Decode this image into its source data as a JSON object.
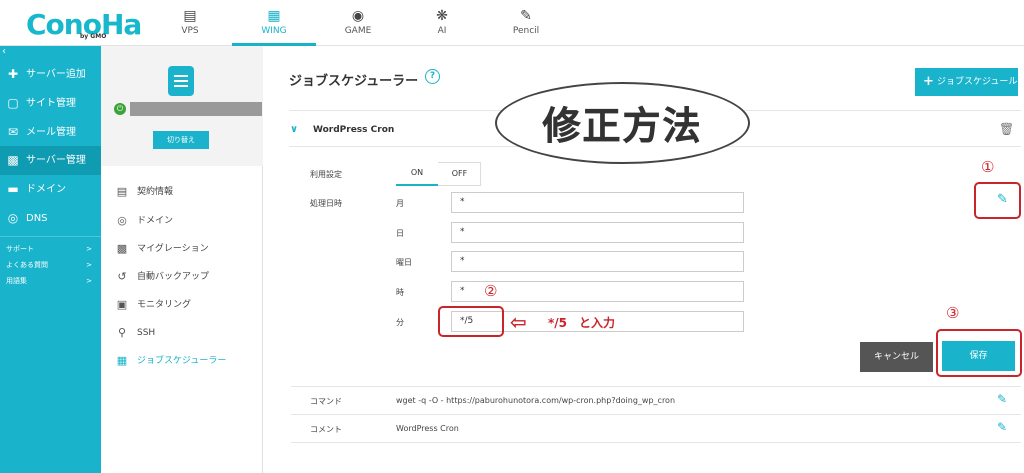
{
  "brand": {
    "logo": "ConoHa",
    "sub": "by GMO"
  },
  "topnav": [
    {
      "label": "VPS",
      "icon": "server-stack-icon"
    },
    {
      "label": "WING",
      "icon": "wing-icon",
      "active": true
    },
    {
      "label": "GAME",
      "icon": "gamepad-icon"
    },
    {
      "label": "AI",
      "icon": "ai-brain-icon"
    },
    {
      "label": "Pencil",
      "icon": "pencil-note-icon"
    }
  ],
  "sidebar": {
    "collapse": "‹",
    "items": [
      {
        "label": "サーバー追加",
        "icon": "plus-icon"
      },
      {
        "label": "サイト管理",
        "icon": "site-icon"
      },
      {
        "label": "メール管理",
        "icon": "mail-icon"
      },
      {
        "label": "サーバー管理",
        "icon": "server-icon",
        "selected": true
      },
      {
        "label": "ドメイン",
        "icon": "domain-icon"
      },
      {
        "label": "DNS",
        "icon": "globe-icon"
      }
    ],
    "links": [
      {
        "label": "サポート"
      },
      {
        "label": "よくある質問"
      },
      {
        "label": "用語集"
      }
    ]
  },
  "server_panel": {
    "switch_label": "切り替え",
    "menu": [
      {
        "label": "契約情報",
        "icon": "contract-icon"
      },
      {
        "label": "ドメイン",
        "icon": "globe-icon"
      },
      {
        "label": "マイグレーション",
        "icon": "migration-icon"
      },
      {
        "label": "自動バックアップ",
        "icon": "backup-icon"
      },
      {
        "label": "モニタリング",
        "icon": "monitor-icon"
      },
      {
        "label": "SSH",
        "icon": "key-icon"
      },
      {
        "label": "ジョブスケジューラー",
        "icon": "scheduler-icon",
        "selected": true
      }
    ]
  },
  "main": {
    "title": "ジョブスケジューラー",
    "help": "?",
    "add_button": "ジョブスケジュール",
    "overlay_text": "修正方法",
    "section_title": "WordPress Cron",
    "usage_label": "利用設定",
    "toggle": {
      "on": "ON",
      "off": "OFF"
    },
    "schedule_label": "処理日時",
    "fields": [
      {
        "label": "月",
        "value": "*"
      },
      {
        "label": "日",
        "value": "*"
      },
      {
        "label": "曜日",
        "value": "*"
      },
      {
        "label": "時",
        "value": "*"
      },
      {
        "label": "分",
        "value": "*/5"
      }
    ],
    "annotations": {
      "one": "①",
      "two": "②",
      "three": "③",
      "arrow": "⇦",
      "note": "*/5　と入力"
    },
    "cancel": "キャンセル",
    "save": "保存",
    "command_label": "コマンド",
    "command_value": "wget -q -O - https://paburohunotora.com/wp-cron.php?doing_wp_cron",
    "comment_label": "コメント",
    "comment_value": "WordPress Cron"
  },
  "colors": {
    "accent": "#19b3cc",
    "annotation": "#c8252a",
    "cancel": "#555555"
  }
}
